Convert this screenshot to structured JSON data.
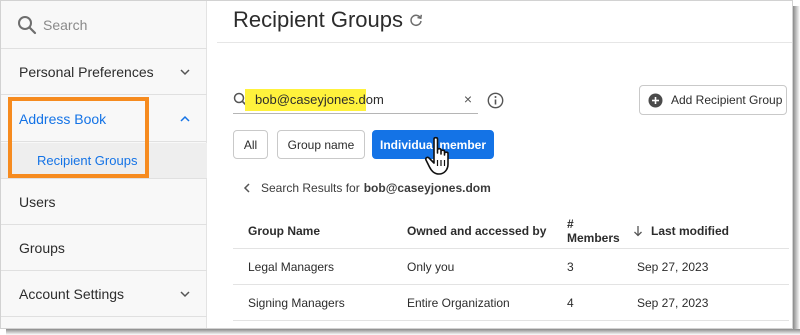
{
  "sidebar": {
    "search_placeholder": "Search",
    "items": [
      {
        "label": "Personal Preferences"
      },
      {
        "label": "Address Book"
      },
      {
        "label": "Recipient Groups"
      },
      {
        "label": "Users"
      },
      {
        "label": "Groups"
      },
      {
        "label": "Account Settings"
      }
    ]
  },
  "main": {
    "title": "Recipient Groups",
    "search_value": "bob@caseyjones.dom",
    "clear_glyph": "×",
    "add_button_label": "Add Recipient Group",
    "filters": [
      {
        "label": "All"
      },
      {
        "label": "Group name"
      },
      {
        "label": "Individual member"
      }
    ],
    "results_prefix": "Search Results for",
    "results_query": "bob@caseyjones.dom"
  },
  "table": {
    "headers": [
      "Group Name",
      "Owned and accessed by",
      "# Members",
      "Last modified"
    ],
    "rows": [
      [
        "Legal Managers",
        "Only you",
        "3",
        "Sep 27, 2023"
      ],
      [
        "Signing Managers",
        "Entire Organization",
        "4",
        "Sep 27, 2023"
      ]
    ]
  },
  "icons": {
    "search": "search-icon",
    "refresh": "refresh-icon",
    "info": "info-icon",
    "add": "plus-circle-icon",
    "back": "chevron-left-icon",
    "sort": "arrow-down-icon",
    "cursor": "hand-cursor-icon"
  },
  "colors": {
    "accent": "#1473e6",
    "highlight_box": "#f68b1f",
    "search_highlight": "#fff23c"
  }
}
